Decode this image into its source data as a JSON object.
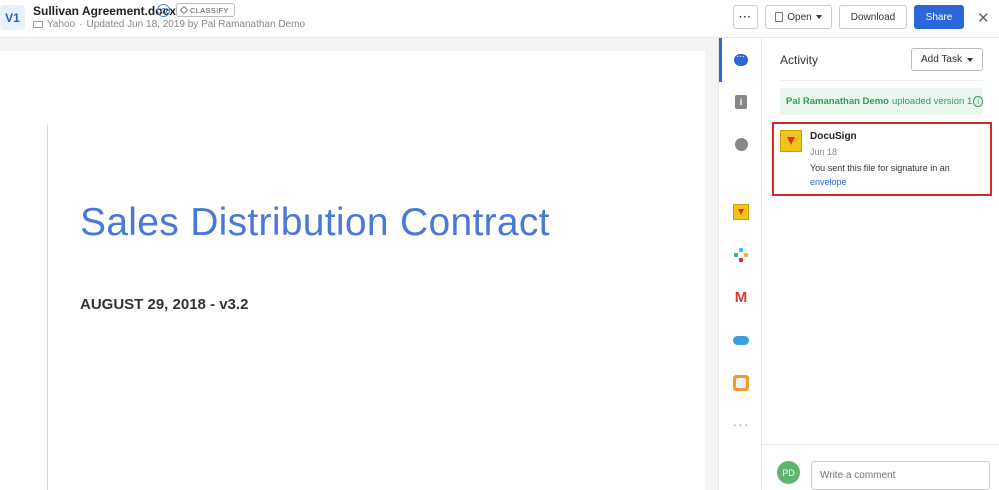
{
  "header": {
    "version": "V1",
    "file_name": "Sullivan Agreement.docx",
    "classify_label": "CLASSIFY",
    "folder": "Yahoo",
    "updated_text": "Updated Jun 18, 2019 by Pal Ramanathan Demo",
    "more_label": "···",
    "open_label": "Open",
    "download_label": "Download",
    "share_label": "Share",
    "close_label": "✕"
  },
  "document": {
    "title": "Sales Distribution Contract",
    "date_line": "AUGUST 29, 2018 - v3.2"
  },
  "rail": {
    "icons": [
      "activity-icon",
      "info-icon",
      "skills-icon",
      "docusign-icon",
      "slack-icon",
      "gmail-icon",
      "salesforce-icon",
      "box-notes-icon",
      "more-icon"
    ]
  },
  "panel": {
    "title": "Activity",
    "add_task_label": "Add Task",
    "upload_user": "Pal Ramanathan Demo",
    "upload_text": "uploaded version 1",
    "card": {
      "app": "DocuSign",
      "date": "Jun 18",
      "text": "You sent this file for signature in an",
      "link": "envelope"
    },
    "avatar_initials": "PD",
    "comment_placeholder": "Write a comment"
  },
  "colors": {
    "accent": "#2b67d8",
    "highlight_border": "#d02a2a",
    "success": "#3a9a5c"
  }
}
